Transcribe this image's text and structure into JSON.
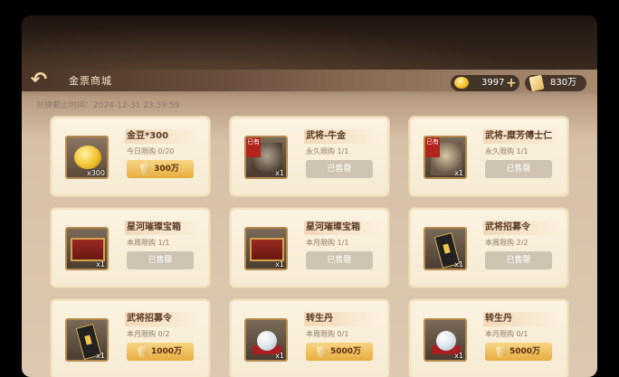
{
  "header": {
    "title": "金票商城",
    "deadline": "兑换截止时间：2024-12-31 23:59:59",
    "currency1": {
      "icon": "gold-bean-icon",
      "value": "3997"
    },
    "currency2": {
      "icon": "gold-ticket-icon",
      "value": "830万"
    }
  },
  "items": [
    {
      "name": "金豆*300",
      "limit": "今日限购 0/20",
      "button": "300万",
      "state": "buy",
      "count": "x300",
      "icon": "gold-bean-icon"
    },
    {
      "name": "武将-牛金",
      "limit": "永久限购 1/1",
      "button": "已售罄",
      "state": "sold",
      "count": "x1",
      "icon": "general-portrait-icon",
      "tag": "已有"
    },
    {
      "name": "武将-糜芳傅士仁",
      "limit": "永久限购 1/1",
      "button": "已售罄",
      "state": "sold",
      "count": "x1",
      "icon": "general-portrait-icon",
      "tag": "已有"
    },
    {
      "name": "星河璀璨宝箱",
      "limit": "本周限购 1/1",
      "button": "已售罄",
      "state": "sold",
      "count": "x1",
      "icon": "treasure-chest-icon"
    },
    {
      "name": "星河璀璨宝箱",
      "limit": "本月限购 1/1",
      "button": "已售罄",
      "state": "sold",
      "count": "x1",
      "icon": "treasure-chest-icon"
    },
    {
      "name": "武将招募令",
      "limit": "本周限购 2/2",
      "button": "已售罄",
      "state": "sold",
      "count": "x1",
      "icon": "recruit-token-icon"
    },
    {
      "name": "武将招募令",
      "limit": "本月限购 0/2",
      "button": "1000万",
      "state": "buy",
      "count": "x1",
      "icon": "recruit-token-icon"
    },
    {
      "name": "转生丹",
      "limit": "本周限购 0/1",
      "button": "5000万",
      "state": "buy",
      "count": "x1",
      "icon": "rebirth-pill-icon"
    },
    {
      "name": "转生丹",
      "limit": "本月限购 0/1",
      "button": "5000万",
      "state": "buy",
      "count": "x1",
      "icon": "rebirth-pill-icon"
    }
  ]
}
